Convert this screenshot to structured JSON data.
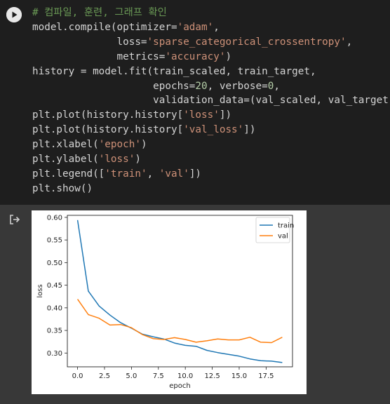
{
  "cell": {
    "code_lines": [
      [
        {
          "t": "# 컴파일, 훈련, 그래프 확인",
          "c": "cm"
        }
      ],
      [
        {
          "t": "model.compile(optimizer="
        },
        {
          "t": "'adam'",
          "c": "st"
        },
        {
          "t": ","
        }
      ],
      [
        {
          "t": "              loss="
        },
        {
          "t": "'sparse_categorical_crossentropy'",
          "c": "st"
        },
        {
          "t": ","
        }
      ],
      [
        {
          "t": "              metrics="
        },
        {
          "t": "'accuracy'",
          "c": "st"
        },
        {
          "t": ")"
        }
      ],
      [
        {
          "t": "history = model.fit(train_scaled, train_target,"
        }
      ],
      [
        {
          "t": "                    epochs="
        },
        {
          "t": "20",
          "c": "nm"
        },
        {
          "t": ", verbose="
        },
        {
          "t": "0",
          "c": "nm"
        },
        {
          "t": ","
        }
      ],
      [
        {
          "t": "                    validation_data=(val_scaled, val_target))"
        }
      ],
      [
        {
          "t": "plt.plot(history.history["
        },
        {
          "t": "'loss'",
          "c": "st"
        },
        {
          "t": "])"
        }
      ],
      [
        {
          "t": "plt.plot(history.history["
        },
        {
          "t": "'val_loss'",
          "c": "st"
        },
        {
          "t": "])"
        }
      ],
      [
        {
          "t": "plt.xlabel("
        },
        {
          "t": "'epoch'",
          "c": "st"
        },
        {
          "t": ")"
        }
      ],
      [
        {
          "t": "plt.ylabel("
        },
        {
          "t": "'loss'",
          "c": "st"
        },
        {
          "t": ")"
        }
      ],
      [
        {
          "t": "plt.legend(["
        },
        {
          "t": "'train'",
          "c": "st"
        },
        {
          "t": ", "
        },
        {
          "t": "'val'",
          "c": "st"
        },
        {
          "t": "])"
        }
      ],
      [
        {
          "t": "plt.show()"
        }
      ]
    ],
    "run_button_icon": "play-icon",
    "output_icon": "output-redirect-icon"
  },
  "chart_data": {
    "type": "line",
    "x": [
      0,
      1,
      2,
      3,
      4,
      5,
      6,
      7,
      8,
      9,
      10,
      11,
      12,
      13,
      14,
      15,
      16,
      17,
      18,
      19
    ],
    "series": [
      {
        "name": "train",
        "color": "#1f77b4",
        "values": [
          0.594,
          0.437,
          0.404,
          0.384,
          0.367,
          0.355,
          0.342,
          0.336,
          0.331,
          0.322,
          0.317,
          0.315,
          0.306,
          0.301,
          0.297,
          0.293,
          0.287,
          0.283,
          0.282,
          0.279
        ]
      },
      {
        "name": "val",
        "color": "#ff7f0e",
        "values": [
          0.419,
          0.385,
          0.377,
          0.362,
          0.363,
          0.356,
          0.341,
          0.332,
          0.33,
          0.334,
          0.33,
          0.324,
          0.327,
          0.331,
          0.329,
          0.329,
          0.335,
          0.324,
          0.323,
          0.335
        ]
      }
    ],
    "xlabel": "epoch",
    "ylabel": "loss",
    "xlim": [
      -0.95,
      19.95
    ],
    "ylim": [
      0.2695,
      0.6045
    ],
    "xticks": [
      "0.0",
      "2.5",
      "5.0",
      "7.5",
      "10.0",
      "12.5",
      "15.0",
      "17.5"
    ],
    "xtick_values": [
      0,
      2.5,
      5,
      7.5,
      10,
      12.5,
      15,
      17.5
    ],
    "yticks": [
      "0.30",
      "0.35",
      "0.40",
      "0.45",
      "0.50",
      "0.55",
      "0.60"
    ],
    "ytick_values": [
      0.3,
      0.35,
      0.4,
      0.45,
      0.5,
      0.55,
      0.6
    ],
    "legend": "top-right",
    "grid": false
  }
}
